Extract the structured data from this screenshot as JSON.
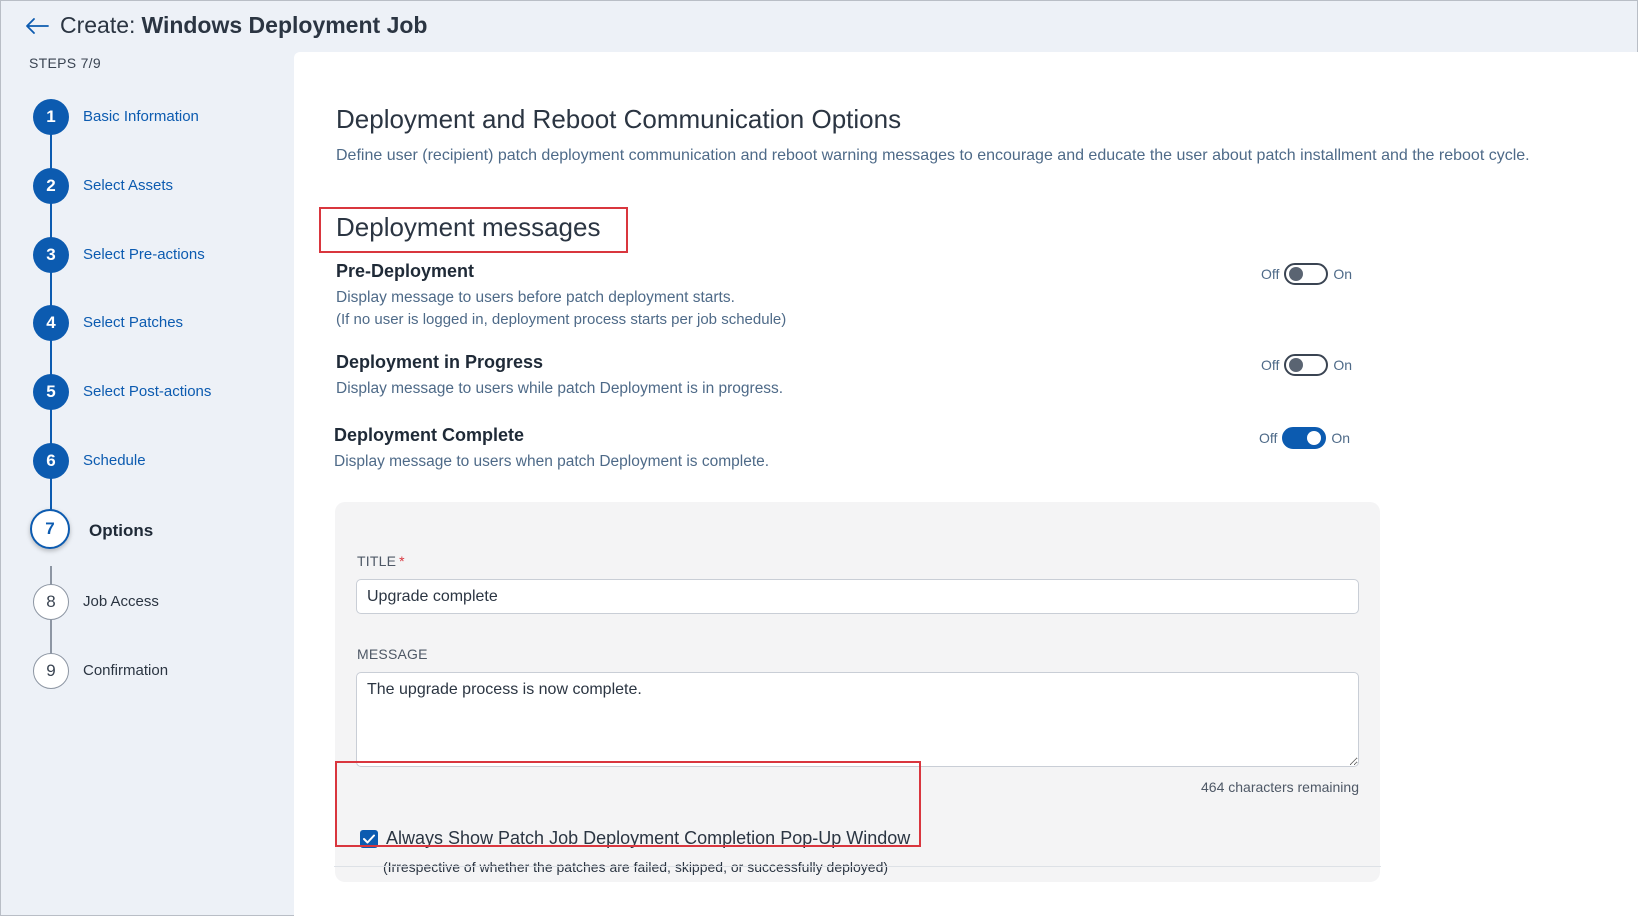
{
  "header": {
    "prefix": "Create:",
    "title": "Windows Deployment Job"
  },
  "sidebar": {
    "steps_count": "STEPS 7/9",
    "steps": [
      {
        "number": "1",
        "label": "Basic Information",
        "state": "done"
      },
      {
        "number": "2",
        "label": "Select Assets",
        "state": "done"
      },
      {
        "number": "3",
        "label": "Select Pre-actions",
        "state": "done"
      },
      {
        "number": "4",
        "label": "Select Patches",
        "state": "done"
      },
      {
        "number": "5",
        "label": "Select Post-actions",
        "state": "done"
      },
      {
        "number": "6",
        "label": "Schedule",
        "state": "done"
      },
      {
        "number": "7",
        "label": "Options",
        "state": "active"
      },
      {
        "number": "8",
        "label": "Job Access",
        "state": "pending"
      },
      {
        "number": "9",
        "label": "Confirmation",
        "state": "pending"
      }
    ]
  },
  "main": {
    "section_title": "Deployment and Reboot Communication Options",
    "section_desc": "Define user (recipient) patch deployment communication and reboot warning messages to encourage and educate the user about patch installment and the reboot cycle.",
    "subsection_title": "Deployment messages",
    "options": [
      {
        "title": "Pre-Deployment",
        "desc": "Display message to users before patch deployment starts.",
        "note": "(If no user is logged in, deployment process starts per job schedule)",
        "toggle_off": "Off",
        "toggle_on": "On",
        "enabled": false
      },
      {
        "title": "Deployment in Progress",
        "desc": "Display message to users while patch Deployment is in progress.",
        "toggle_off": "Off",
        "toggle_on": "On",
        "enabled": false
      },
      {
        "title": "Deployment Complete",
        "desc": "Display message to users when patch Deployment is complete.",
        "toggle_off": "Off",
        "toggle_on": "On",
        "enabled": true
      }
    ],
    "form": {
      "title_label": "TITLE",
      "required_mark": "*",
      "title_value": "Upgrade complete",
      "message_label": "MESSAGE",
      "message_value": "The upgrade process is now complete.",
      "chars_remaining": "464 characters remaining",
      "checkbox_label": "Always Show Patch Job Deployment Completion Pop-Up Window",
      "checkbox_note": "(Irrespective of whether the patches are failed, skipped, or successfully deployed)",
      "checkbox_checked": true
    }
  },
  "colors": {
    "accent": "#0c5bb0",
    "highlight": "#d9363e",
    "background": "#edf1f7"
  }
}
